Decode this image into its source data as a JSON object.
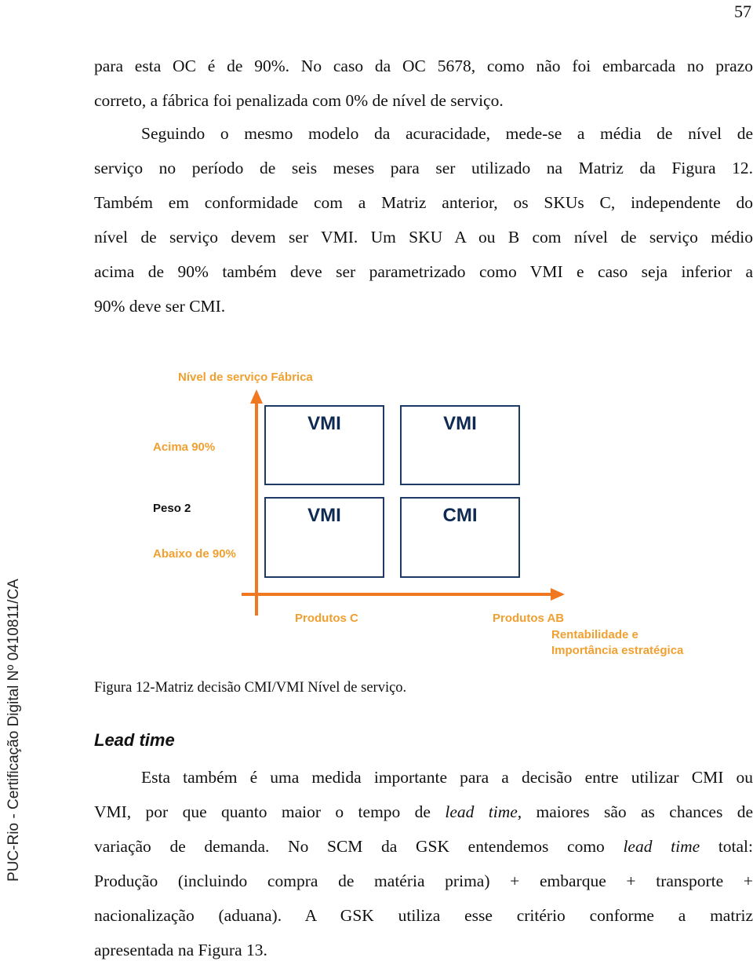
{
  "page": {
    "number": "57",
    "side_stamp": "PUC-Rio - Certificação Digital Nº 0410811/CA"
  },
  "paragraph1": {
    "lines": [
      "para esta OC é de 90%. No caso da OC 5678, como não foi embarcada no prazo",
      "correto, a fábrica foi penalizada com 0% de nível de serviço."
    ]
  },
  "paragraph2": {
    "lines": [
      "Seguindo o mesmo modelo da acuracidade, mede-se a média de nível de",
      "serviço no período de seis meses para ser utilizado na Matriz da Figura 12.",
      "Também em conformidade com a Matriz anterior, os SKUs C, independente do",
      "nível de serviço devem ser VMI. Um SKU A ou B com nível de serviço médio",
      "acima de 90% também deve ser parametrizado como VMI e caso seja inferior a",
      "90% deve ser CMI."
    ]
  },
  "figure": {
    "y_axis_title": "Nível de serviço Fábrica",
    "y_labels": {
      "high": "Acima 90%",
      "weight": "Peso 2",
      "low": "Abaixo de 90%"
    },
    "x_labels": {
      "left": "Produtos C",
      "right": "Produtos AB",
      "axis_title_line1": "Rentabilidade e",
      "axis_title_line2": "Importância estratégica"
    },
    "cells": {
      "top_left": "VMI",
      "top_right": "VMI",
      "bottom_left": "VMI",
      "bottom_right": "CMI"
    },
    "colors": {
      "axis": "#f07820",
      "label": "#f0a030",
      "box_border": "#1d3a66",
      "box_text": "#0f2a52"
    },
    "caption": "Figura 12-Matriz decisão CMI/VMI Nível de serviço."
  },
  "section": {
    "heading": "Lead time"
  },
  "paragraph3": {
    "line1": "Esta também é uma medida importante para a decisão entre utilizar CMI ou",
    "line2_a": "VMI, por que quanto maior o tempo de ",
    "line2_em": "lead time",
    "line2_b": ", maiores são as chances de",
    "line3_a": "variação de demanda. No SCM da GSK entendemos como ",
    "line3_em": "lead time",
    "line3_b": " total:",
    "line4": "Produção (incluindo compra de matéria prima) + embarque + transporte +",
    "line5": "nacionalização (aduana). A GSK utiliza esse critério conforme a matriz",
    "line6": "apresentada na Figura 13."
  }
}
